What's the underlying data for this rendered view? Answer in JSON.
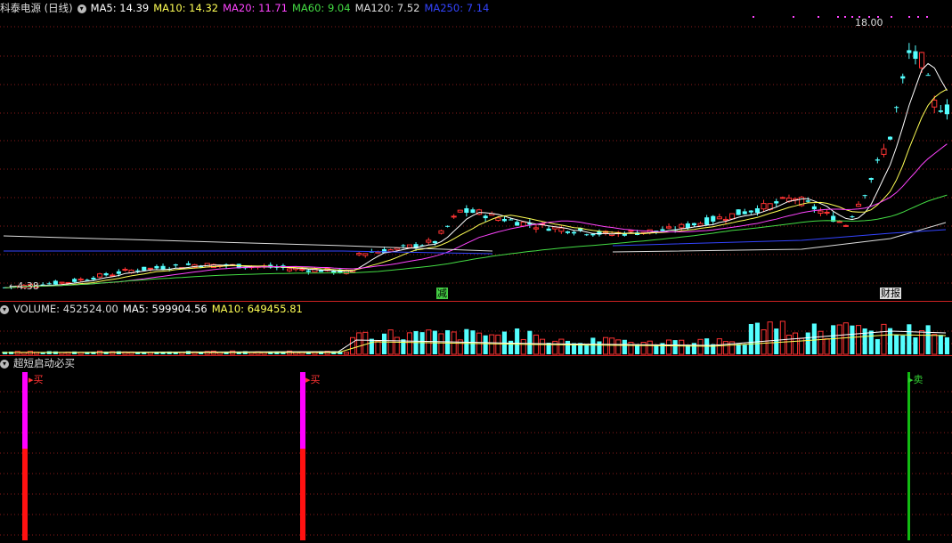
{
  "price_header": {
    "title": "科泰电源 (日线)",
    "ma5_label": "MA5:",
    "ma5": "14.39",
    "ma10_label": "MA10:",
    "ma10": "14.32",
    "ma20_label": "MA20:",
    "ma20": "11.71",
    "ma60_label": "MA60:",
    "ma60": "9.04",
    "ma120_label": "MA120:",
    "ma120": "7.52",
    "ma250_label": "MA250:",
    "ma250": "7.14"
  },
  "volume_header": {
    "title": "VOLUME:",
    "volume": "452524.00",
    "ma5_label": "MA5:",
    "ma5": "599904.56",
    "ma10_label": "MA10:",
    "ma10": "649455.81"
  },
  "indicator_header": {
    "title": "超短启动必买"
  },
  "annotations": {
    "high_label": "18.00",
    "low_label": "4.38",
    "event_reduce": "减",
    "event_report": "财报",
    "buy_label_1": "买",
    "buy_label_2": "买",
    "sell_label": "卖"
  },
  "colors": {
    "background": "#000000",
    "up": "#ff3333",
    "down": "#54ffff",
    "ma5": "#ffffff",
    "ma10": "#ffff55",
    "ma20": "#ff44ff",
    "ma60": "#44dd44",
    "ma120": "#dddddd",
    "ma250": "#3344ff",
    "grid": "#8a1a1a",
    "buy_top": "#ff00ff",
    "buy_bottom": "#ff1111",
    "sell": "#11bb11"
  },
  "chart_data": {
    "type": "candlestick",
    "price_extremes": {
      "high": 18.0,
      "low": 4.38
    },
    "moving_averages_last": {
      "MA5": 14.39,
      "MA10": 14.32,
      "MA20": 11.71,
      "MA60": 9.04,
      "MA120": 7.52,
      "MA250": 7.14
    },
    "volume_last": 452524.0,
    "volume_ma_last": {
      "MA5": 599904.56,
      "MA10": 649455.81
    },
    "signals": [
      {
        "type": "buy",
        "label": "买",
        "position": "early"
      },
      {
        "type": "buy",
        "label": "买",
        "position": "early"
      },
      {
        "type": "sell",
        "label": "卖",
        "position": "latest"
      }
    ]
  }
}
